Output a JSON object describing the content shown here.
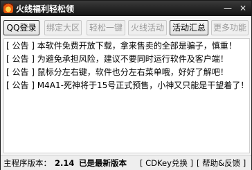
{
  "window": {
    "title": "火线福利轻松领",
    "min": "—",
    "close": "✕"
  },
  "toolbar": {
    "buttons": [
      {
        "label": "QQ登录",
        "state": "active"
      },
      {
        "label": "绑定大区",
        "state": "disabled"
      },
      {
        "label": "轻松一键",
        "state": "disabled"
      },
      {
        "label": "火线活动",
        "state": "disabled"
      },
      {
        "label": "活动汇总",
        "state": "active"
      },
      {
        "label": "更多功能",
        "state": "disabled"
      }
    ]
  },
  "notices": [
    "[ 公告 ] 本软件免费开放下载，拿来售卖的全部是骗子，慎重！",
    "[ 公告 ] 为避免承担风险，建议不要同时运行软件及客户端！",
    "[ 公告 ] 鼠标分左右键，软件也分左右菜单哦，好好了解吧！",
    "[ 公告 ] M4A1-死神将于15号正式预售，小神又只能是干望着了！"
  ],
  "status": {
    "version_label": "主程序版本：",
    "version": "2.14",
    "latest": "已是最新版本",
    "cdkey": "[ CDKey兑换 ]",
    "feedback": "[ 帮助&反馈 ]"
  },
  "colors": {
    "titlebar": "#1f1f1f",
    "accent": "#ff7a1a"
  }
}
